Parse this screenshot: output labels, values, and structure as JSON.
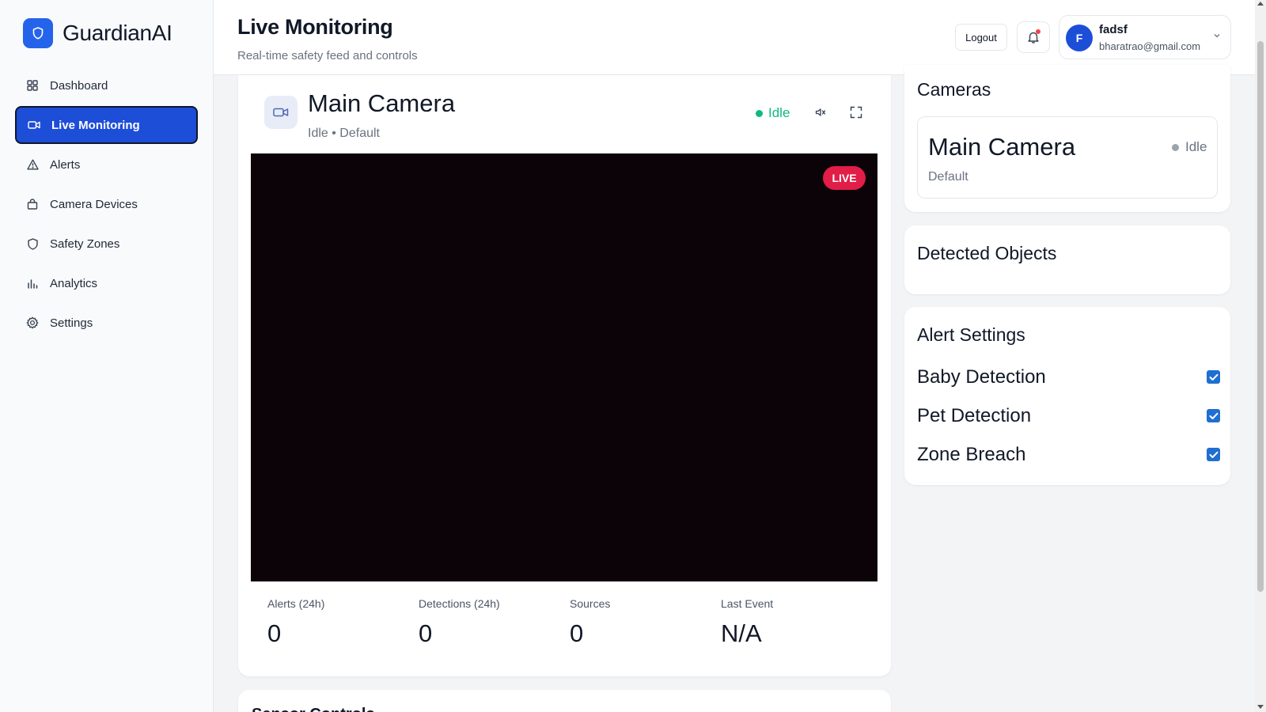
{
  "brand": {
    "name": "GuardianAI",
    "logo_icon": "shield-icon",
    "color": "#2563eb"
  },
  "sidebar": {
    "items": [
      {
        "label": "Dashboard",
        "icon": "grid-icon",
        "active": false
      },
      {
        "label": "Live Monitoring",
        "icon": "video-camera-icon",
        "active": true
      },
      {
        "label": "Alerts",
        "icon": "warning-triangle-icon",
        "active": false
      },
      {
        "label": "Camera Devices",
        "icon": "bag-icon",
        "active": false
      },
      {
        "label": "Safety Zones",
        "icon": "shield-icon",
        "active": false
      },
      {
        "label": "Analytics",
        "icon": "bar-chart-icon",
        "active": false
      },
      {
        "label": "Settings",
        "icon": "gear-icon",
        "active": false
      }
    ],
    "active_color": "#1d4ed8"
  },
  "header": {
    "title": "Live Monitoring",
    "subtitle": "Real-time safety feed and controls",
    "logout_label": "Logout",
    "user": {
      "initial": "F",
      "name": "fadsf",
      "email": "bharatrao@gmail.com"
    }
  },
  "main_camera": {
    "name": "Main Camera",
    "subtitle": "Idle • Default",
    "status": "Idle",
    "status_color": "#10b981",
    "live_label": "LIVE",
    "live_color": "#e11d48",
    "stats": [
      {
        "label": "Alerts (24h)",
        "value": "0"
      },
      {
        "label": "Detections (24h)",
        "value": "0"
      },
      {
        "label": "Sources",
        "value": "0"
      },
      {
        "label": "Last Event",
        "value": "N/A"
      }
    ]
  },
  "next_section": {
    "title": "Sensor Controls"
  },
  "cameras_panel": {
    "title": "Cameras",
    "items": [
      {
        "name": "Main Camera",
        "subtitle": "Default",
        "status": "Idle"
      }
    ]
  },
  "detected_panel": {
    "title": "Detected Objects"
  },
  "alert_settings": {
    "title": "Alert Settings",
    "toggles": [
      {
        "label": "Baby Detection",
        "checked": true
      },
      {
        "label": "Pet Detection",
        "checked": true
      },
      {
        "label": "Zone Breach",
        "checked": true
      }
    ]
  }
}
